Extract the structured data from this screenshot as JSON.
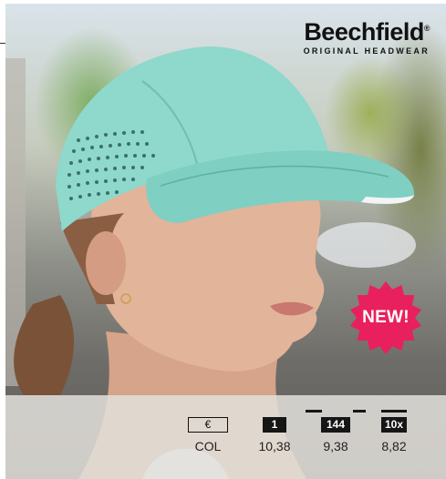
{
  "brand": {
    "name": "Beechfield",
    "tagline": "ORIGINAL HEADWEAR",
    "trademark": "®"
  },
  "badge": {
    "label": "NEW!",
    "color": "#e8205e"
  },
  "pricing": {
    "currency_header": "€",
    "columns": [
      {
        "header": "€",
        "value": "COL"
      },
      {
        "header": "1",
        "value": "10,38"
      },
      {
        "header": "144",
        "value": "9,38"
      },
      {
        "header": "10x",
        "value": "8,82"
      }
    ]
  },
  "colors": {
    "cap": "#8ed8cc",
    "badge": "#e8205e",
    "panel": "#e2dfdb"
  }
}
